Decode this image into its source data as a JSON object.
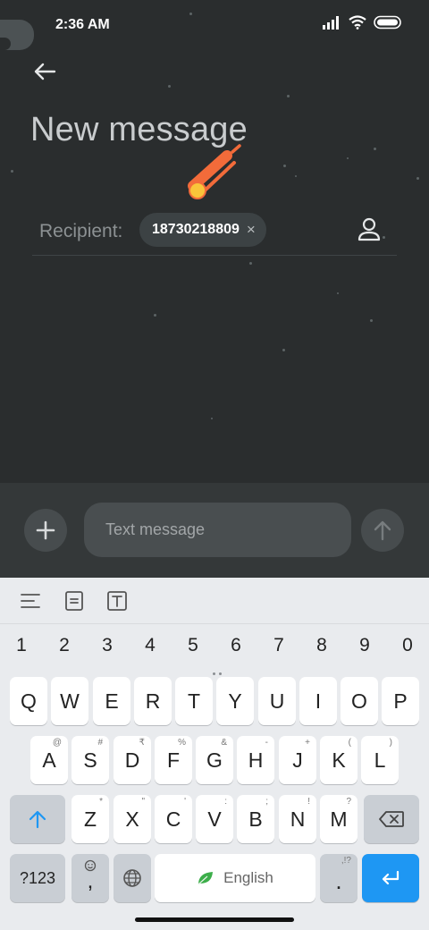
{
  "status_bar": {
    "time": "2:36 AM"
  },
  "header": {
    "title": "New message"
  },
  "recipient": {
    "label": "Recipient:",
    "chip_number": "18730218809",
    "chip_remove": "×"
  },
  "compose": {
    "placeholder": "Text message"
  },
  "keyboard": {
    "number_row": [
      "1",
      "2",
      "3",
      "4",
      "5",
      "6",
      "7",
      "8",
      "9",
      "0"
    ],
    "row1": [
      "Q",
      "W",
      "E",
      "R",
      "T",
      "Y",
      "U",
      "I",
      "O",
      "P"
    ],
    "row2": [
      {
        "key": "A",
        "hint": "@"
      },
      {
        "key": "S",
        "hint": "#"
      },
      {
        "key": "D",
        "hint": "₹"
      },
      {
        "key": "F",
        "hint": "%"
      },
      {
        "key": "G",
        "hint": "&"
      },
      {
        "key": "H",
        "hint": "-"
      },
      {
        "key": "J",
        "hint": "+"
      },
      {
        "key": "K",
        "hint": "("
      },
      {
        "key": "L",
        "hint": ")"
      }
    ],
    "row3": [
      {
        "key": "Z",
        "hint": "*"
      },
      {
        "key": "X",
        "hint": "\""
      },
      {
        "key": "C",
        "hint": "'"
      },
      {
        "key": "V",
        "hint": ":"
      },
      {
        "key": "B",
        "hint": ";"
      },
      {
        "key": "N",
        "hint": "!"
      },
      {
        "key": "M",
        "hint": "?"
      }
    ],
    "symbols_key": "?123",
    "comma_key": ",",
    "period_key": ".",
    "period_hint": ",!?",
    "space_label": "English"
  },
  "colors": {
    "app_background": "#2a2d2e",
    "compose_background": "#343839",
    "keyboard_background": "#e9ebee",
    "accent_blue": "#1e97f3",
    "meteor_orange": "#f26b3a",
    "meteor_yellow": "#f9c43a"
  },
  "icons": [
    "back-arrow-icon",
    "signal-icon",
    "wifi-icon",
    "battery-icon",
    "meteor-icon",
    "contact-icon",
    "plus-icon",
    "send-arrow-icon",
    "menu-lines-icon",
    "document-icon",
    "text-box-icon",
    "shift-icon",
    "backspace-icon",
    "emoji-icon",
    "globe-icon",
    "leaf-icon",
    "enter-icon"
  ]
}
